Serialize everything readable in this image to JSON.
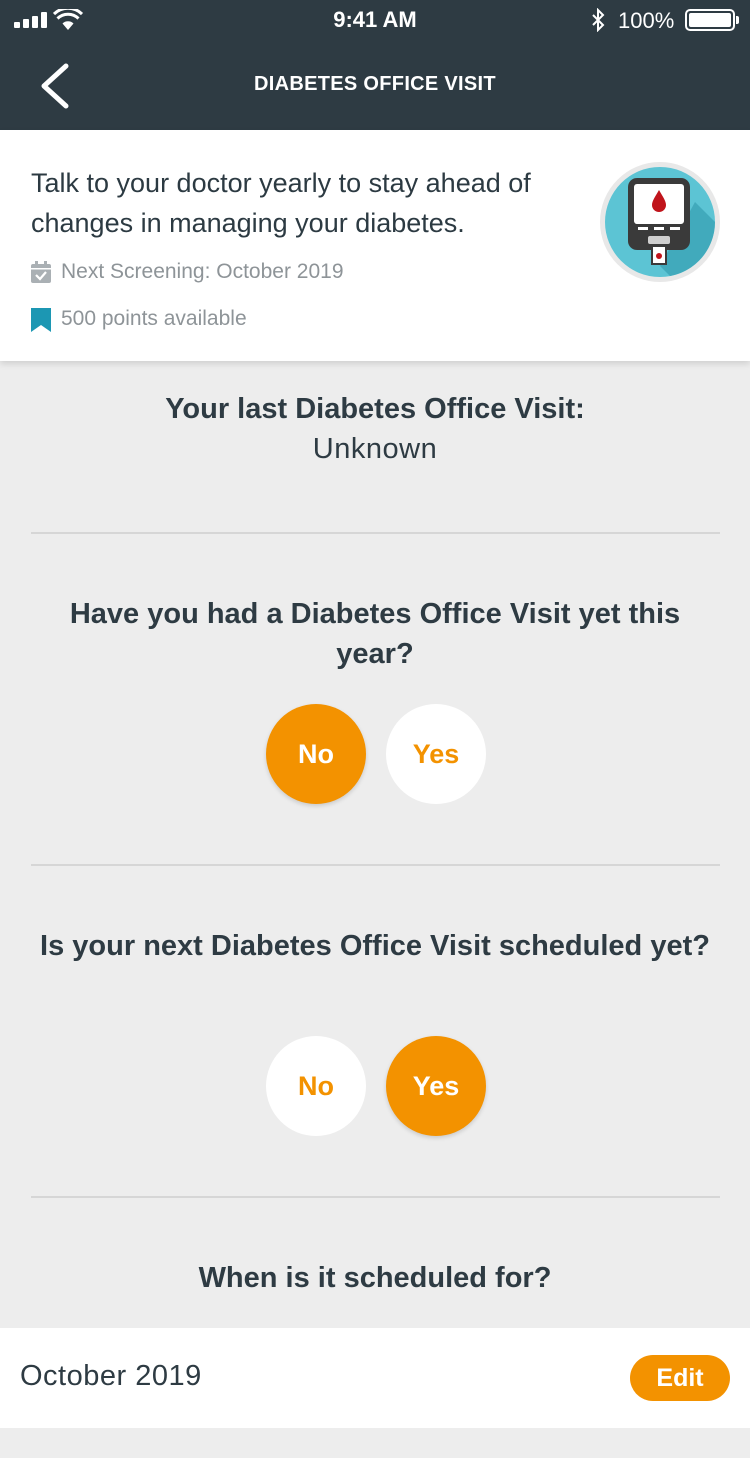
{
  "status_bar": {
    "time": "9:41 AM",
    "battery": "100%"
  },
  "nav": {
    "title": "DIABETES OFFICE VISIT",
    "back_icon": "chevron-left-icon"
  },
  "card": {
    "description": "Talk to your doctor yearly to stay ahead of changes in managing your diabetes.",
    "next_screening": "Next Screening: October 2019",
    "points": "500 points available",
    "badge_icon": "glucose-meter-icon"
  },
  "last_visit": {
    "heading": "Your last Diabetes Office Visit:",
    "value": "Unknown"
  },
  "question1": {
    "text": "Have you had a Diabetes Office Visit yet this year?",
    "no_label": "No",
    "yes_label": "Yes",
    "selected": "No"
  },
  "question2": {
    "text": "Is your next Diabetes Office Visit scheduled yet?",
    "no_label": "No",
    "yes_label": "Yes",
    "selected": "Yes"
  },
  "question3": {
    "text": "When is it scheduled for?"
  },
  "scheduled": {
    "value": "October 2019",
    "edit_label": "Edit"
  },
  "colors": {
    "header": "#2e3b43",
    "accent": "#f39200",
    "badge": "#2aa6bb",
    "background": "#ededed"
  }
}
